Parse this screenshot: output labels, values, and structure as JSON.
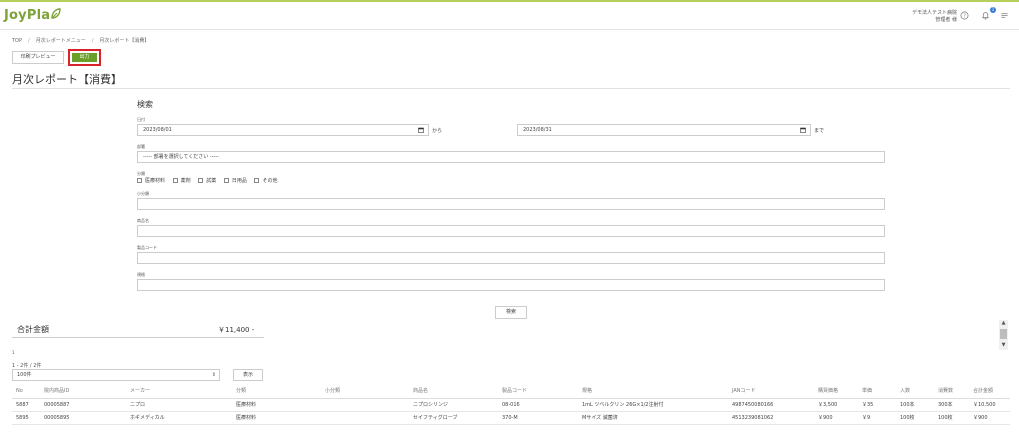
{
  "header": {
    "logo": "JoyPla",
    "company": "デモ法人テスト病院",
    "user": "管理者 様",
    "notification_count": "1"
  },
  "breadcrumb": [
    "TOP",
    "月次レポートメニュー",
    "月次レポート【消費】"
  ],
  "actions": {
    "print_preview": "印刷プレビュー",
    "output": "出力"
  },
  "page_title": "月次レポート【消費】",
  "search": {
    "title": "検索",
    "date_label": "日付",
    "date_from": "2023/08/01",
    "date_to": "2023/08/31",
    "from_text": "から",
    "to_text": "まで",
    "dept_label": "部署",
    "dept_placeholder": "----- 部署を選択してください -----",
    "category_label": "分類",
    "categories": [
      "医療材料",
      "薬剤",
      "試薬",
      "日用品",
      "その他"
    ],
    "subcategory_label": "小分類",
    "product_name_label": "商品名",
    "product_code_label": "製品コード",
    "spec_label": "規格",
    "search_button": "検索"
  },
  "summary": {
    "total_label": "合計金額",
    "total_value": "￥11,400 -"
  },
  "pager": {
    "page": "1",
    "count_text": "1 - 2件 / 2件",
    "per_page": "100件",
    "display_button": "表示"
  },
  "table": {
    "headers": [
      "No",
      "院内商品ID",
      "メーカー",
      "分類",
      "小分類",
      "商品名",
      "製品コード",
      "規格",
      "JANコード",
      "購買価格",
      "単価",
      "入数",
      "消費数",
      "合計金額"
    ],
    "rows": [
      [
        "5887",
        "00005887",
        "ニプロ",
        "医療材料",
        "",
        "ニプロシリンジ",
        "08-016",
        "1mL ツベルクリン 26G×1/2注射付",
        "4987450080166",
        "￥3,500",
        "￥35",
        "100本",
        "300本",
        "￥10,500"
      ],
      [
        "5895",
        "00005895",
        "ホギメディカル",
        "医療材料",
        "",
        "セイフティグローブ",
        "370-M",
        "Mサイズ 滅菌済",
        "4513239081062",
        "￥900",
        "￥9",
        "100枚",
        "100枚",
        "￥900"
      ]
    ]
  }
}
